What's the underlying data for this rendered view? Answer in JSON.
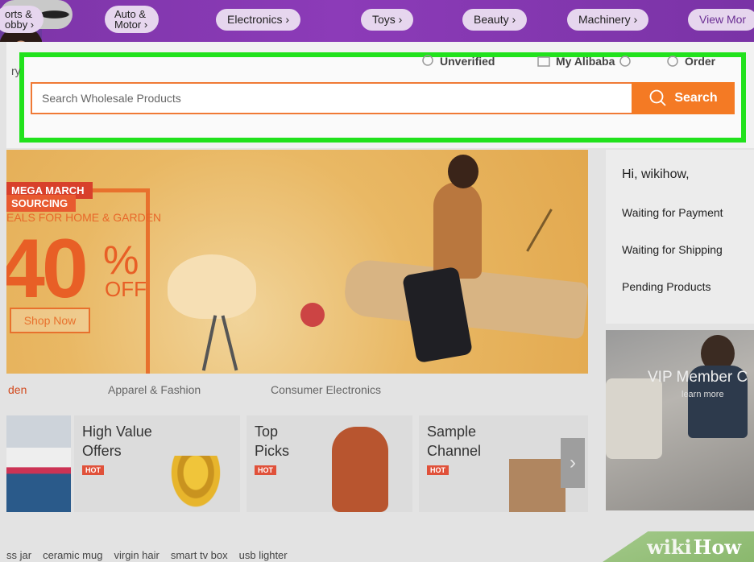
{
  "categories": [
    {
      "label": "orts &\nobby ›"
    },
    {
      "label": "Auto &\nMotor ›"
    },
    {
      "label": "Electronics ›"
    },
    {
      "label": "Toys ›"
    },
    {
      "label": "Beauty ›"
    },
    {
      "label": "Machinery ›"
    },
    {
      "label": "View Mor"
    }
  ],
  "header": {
    "left_cut": "ry",
    "links": [
      "Unverified",
      "My Alibaba",
      "Order"
    ]
  },
  "search": {
    "placeholder": "Search Wholesale Products",
    "button_label": "Search"
  },
  "hero": {
    "tag_line1": "MEGA MARCH",
    "tag_line2": "SOURCING",
    "subtitle": "EALS FOR HOME & GARDEN",
    "big_number": "40",
    "percent": "%",
    "off": "OFF",
    "cta": "Shop Now"
  },
  "sidebar": {
    "greeting": "Hi, wikihow,",
    "links": [
      "Waiting for Payment",
      "Waiting for Shipping",
      "Pending Products"
    ]
  },
  "vip": {
    "title": "VIP Member C",
    "subtitle": "learn more"
  },
  "industry_tabs": [
    "den",
    "Apparel & Fashion",
    "Consumer Electronics"
  ],
  "features": [
    {
      "title": "High Value\nOffers",
      "badge": "HOT"
    },
    {
      "title": "Top\nPicks",
      "badge": "HOT"
    },
    {
      "title": "Sample\nChannel",
      "badge": "HOT"
    }
  ],
  "next_arrow": "›",
  "keywords": [
    "ss jar",
    "ceramic mug",
    "virgin hair",
    "smart tv box",
    "usb lighter"
  ],
  "watermark": {
    "wiki": "wiki",
    "how": "How"
  },
  "colors": {
    "accent": "#f47a24",
    "highlight": "#21e21c",
    "category_bar": "#8138ad",
    "hot_badge": "#e0513a"
  }
}
